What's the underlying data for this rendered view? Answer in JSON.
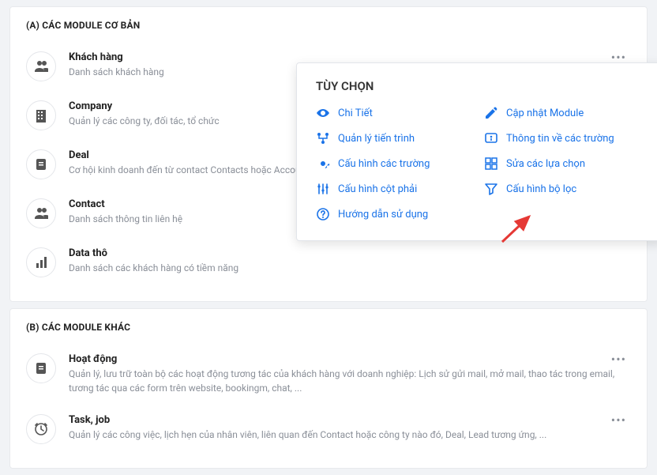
{
  "sections": {
    "a": {
      "title": "(A) CÁC MODULE CƠ BẢN"
    },
    "b": {
      "title": "(B) CÁC MODULE KHÁC"
    }
  },
  "modules_a": [
    {
      "icon": "users",
      "title": "Khách hàng",
      "desc": "Danh sách khách hàng",
      "more": true
    },
    {
      "icon": "building",
      "title": "Company",
      "desc": "Quản lý các công ty, đối tác, tổ chức"
    },
    {
      "icon": "doc",
      "title": "Deal",
      "desc": "Cơ hội kinh doanh đến từ contact Contacts hoặc Accou"
    },
    {
      "icon": "users",
      "title": "Contact",
      "desc": "Danh sách thông tin liên hệ"
    },
    {
      "icon": "bars",
      "title": "Data thô",
      "desc": "Danh sách các khách hàng có tiềm năng"
    }
  ],
  "modules_b": [
    {
      "icon": "doc",
      "title": "Hoạt động",
      "desc": "Quản lý, lưu trữ toàn bộ các hoạt động tương tác của khách hàng với doanh nghiệp: Lịch sử gửi mail, mở mail, thao tác trong email, tương tác qua các form trên website, bookingm, chat, ...",
      "more": true
    },
    {
      "icon": "clock",
      "title": "Task, job",
      "desc": "Quản lý các công việc, lịch hẹn của nhân viên, liên quan đến Contact hoặc công ty nào đó, Deal, Lead tương ứng, ...",
      "more": true
    }
  ],
  "popover": {
    "title": "TÙY CHỌN",
    "options": [
      {
        "icon": "eye",
        "label": "Chi Tiết"
      },
      {
        "icon": "pencil",
        "label": "Cập nhật Module"
      },
      {
        "icon": "flow",
        "label": "Quản lý tiến trình"
      },
      {
        "icon": "info",
        "label": "Thông tin về các trường"
      },
      {
        "icon": "gear",
        "label": "Cấu hình các trường"
      },
      {
        "icon": "grid",
        "label": "Sửa các lựa chọn"
      },
      {
        "icon": "sliders",
        "label": "Cấu hình cột phải"
      },
      {
        "icon": "funnel",
        "label": "Cấu hình bộ lọc"
      },
      {
        "icon": "question",
        "label": "Hướng dẫn sử dụng"
      }
    ]
  },
  "more_glyph": "•••"
}
